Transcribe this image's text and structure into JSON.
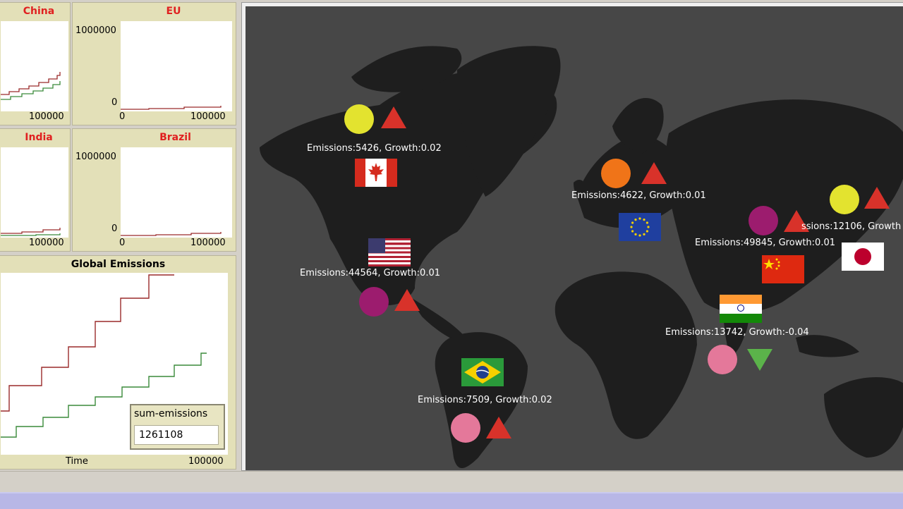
{
  "plots": {
    "china": {
      "title": "China",
      "x_max": "100000"
    },
    "eu": {
      "title": "EU",
      "y_max": "1000000",
      "y_min": "0",
      "x_min": "0",
      "x_max": "100000"
    },
    "india": {
      "title": "India",
      "x_max": "100000"
    },
    "brazil": {
      "title": "Brazil",
      "y_max": "1000000",
      "y_min": "0",
      "x_min": "0",
      "x_max": "100000"
    },
    "global": {
      "title": "Global Emissions",
      "x_label": "Time",
      "x_max": "100000"
    }
  },
  "monitor": {
    "label": "sum-emissions",
    "value": "1261108"
  },
  "countries": {
    "canada": {
      "label": "Emissions:5426, Growth:0.02",
      "circle_color": "#e3e32f",
      "trend": "up"
    },
    "usa": {
      "label": "Emissions:44564, Growth:0.01",
      "circle_color": "#9c1c6e",
      "trend": "up"
    },
    "brazil": {
      "label": "Emissions:7509, Growth:0.02",
      "circle_color": "#e4789a",
      "trend": "up"
    },
    "eu": {
      "label": "Emissions:4622, Growth:0.01",
      "circle_color": "#f07418",
      "trend": "up"
    },
    "china": {
      "label": "Emissions:49845, Growth:0.01",
      "circle_color": "#9c1c6e",
      "trend": "up"
    },
    "japan": {
      "label": "ssions:12106, Growth",
      "circle_color": "#e3e32f",
      "trend": "up"
    },
    "india": {
      "label": "Emissions:13742, Growth:-0.04",
      "circle_color": "#e4789a",
      "trend": "down"
    }
  },
  "colors": {
    "trend_up": "#d8322a",
    "trend_down": "#5bb34a",
    "world_bg": "#474747",
    "land": "#1e1e1e",
    "plot_title": "#e02020"
  }
}
